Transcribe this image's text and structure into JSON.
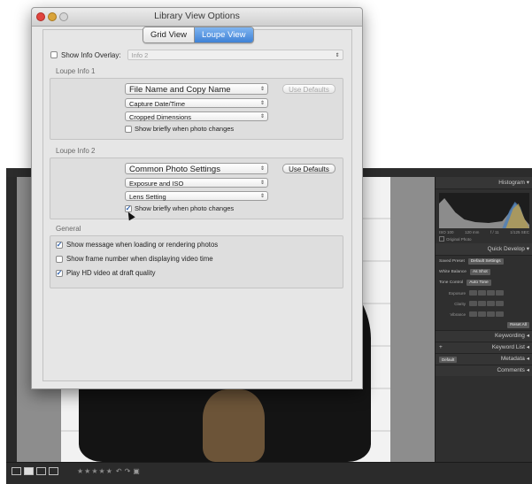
{
  "dialog": {
    "title": "Library View Options",
    "tabs": [
      {
        "label": "Grid View",
        "selected": false
      },
      {
        "label": "Loupe View",
        "selected": true
      }
    ],
    "show_info_overlay": {
      "label": "Show Info Overlay:",
      "checked": false,
      "value": "Info 2"
    },
    "loupe_info_1": {
      "label": "Loupe Info 1",
      "fields": [
        "File Name and Copy Name",
        "Capture Date/Time",
        "Cropped Dimensions"
      ],
      "show_briefly": {
        "label": "Show briefly when photo changes",
        "checked": false
      },
      "use_defaults": "Use Defaults"
    },
    "loupe_info_2": {
      "label": "Loupe Info 2",
      "fields": [
        "Common Photo Settings",
        "Exposure and ISO",
        "Lens Setting"
      ],
      "show_briefly": {
        "label": "Show briefly when photo changes",
        "checked": true
      },
      "use_defaults": "Use Defaults"
    },
    "general": {
      "label": "General",
      "options": [
        {
          "label": "Show message when loading or rendering photos",
          "checked": true
        },
        {
          "label": "Show frame number when displaying video time",
          "checked": false
        },
        {
          "label": "Play HD video at draft quality",
          "checked": true
        }
      ]
    },
    "accent": "#3f82d6"
  },
  "lightroom": {
    "right_panel": {
      "histogram": "Histogram",
      "histo_info": [
        "ISO 100",
        "120 mm",
        "f / 11",
        "1/125 SEC"
      ],
      "original_photo": "Original Photo",
      "quick_develop": "Quick Develop",
      "saved_preset": {
        "label": "Saved Preset",
        "value": "Default Settings"
      },
      "white_balance": {
        "label": "White Balance",
        "value": "As Shot"
      },
      "tone_control": {
        "label": "Tone Control",
        "value": "Auto Tone"
      },
      "exposure": "Exposure",
      "clarity": "Clarity",
      "vibrance": "Vibrance",
      "reset_all": "Reset All",
      "keywording": "Keywording",
      "keyword_list": "Keyword List",
      "metadata": "Metadata",
      "metadata_preset": "Default",
      "comments": "Comments",
      "plus_sign": "+"
    },
    "toolbar": {
      "stars": "★★★★★"
    }
  }
}
